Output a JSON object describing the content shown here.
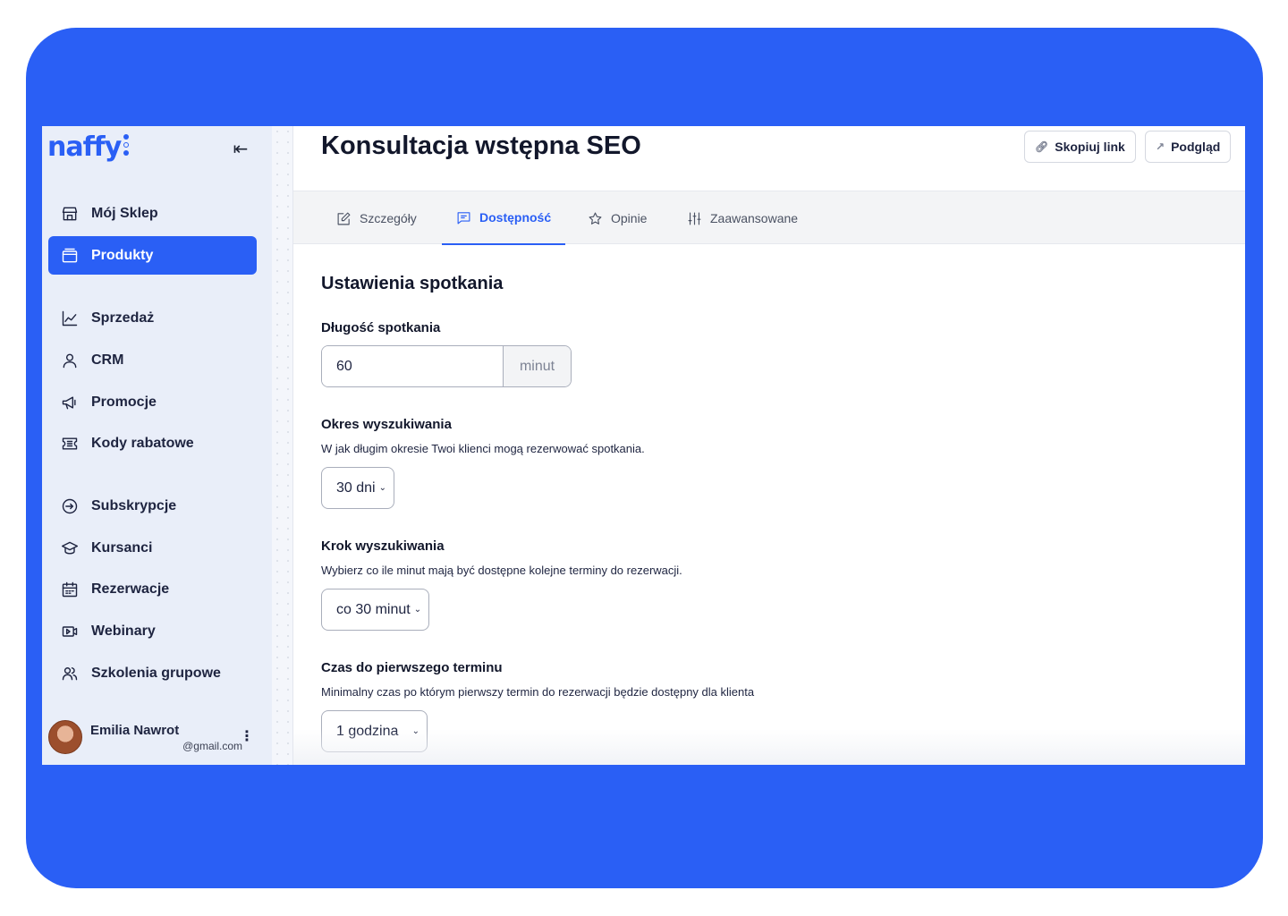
{
  "sidebar": {
    "logo": "naffy",
    "items": [
      {
        "label": "Mój Sklep",
        "icon": "store-icon"
      },
      {
        "label": "Produkty",
        "icon": "folder-icon",
        "active": true
      },
      {
        "label": "Sprzedaż",
        "icon": "chart-line-icon"
      },
      {
        "label": "CRM",
        "icon": "user-icon"
      },
      {
        "label": "Promocje",
        "icon": "megaphone-icon"
      },
      {
        "label": "Kody rabatowe",
        "icon": "ticket-icon"
      },
      {
        "label": "Subskrypcje",
        "icon": "subscription-icon"
      },
      {
        "label": "Kursanci",
        "icon": "graduation-cap-icon"
      },
      {
        "label": "Rezerwacje",
        "icon": "calendar-icon"
      },
      {
        "label": "Webinary",
        "icon": "video-icon"
      },
      {
        "label": "Szkolenia grupowe",
        "icon": "users-icon"
      }
    ],
    "user": {
      "name": "Emilia Nawrot",
      "email": "@gmail.com"
    }
  },
  "header": {
    "title": "Konsultacja wstępna SEO",
    "copy_link": "Skopiuj link",
    "preview": "Podgląd"
  },
  "tabs": [
    {
      "label": "Szczegóły",
      "icon": "edit-icon"
    },
    {
      "label": "Dostępność",
      "icon": "message-icon",
      "active": true
    },
    {
      "label": "Opinie",
      "icon": "star-icon"
    },
    {
      "label": "Zaawansowane",
      "icon": "sliders-icon"
    }
  ],
  "form": {
    "section_title": "Ustawienia spotkania",
    "duration": {
      "label": "Długość spotkania",
      "value": "60",
      "suffix": "minut"
    },
    "period": {
      "label": "Okres wyszukiwania",
      "description": "W jak długim okresie Twoi klienci mogą rezerwować spotkania.",
      "value": "30 dni"
    },
    "step": {
      "label": "Krok wyszukiwania",
      "description": "Wybierz co ile minut mają być dostępne kolejne terminy do rezerwacji.",
      "value": "co 30 minut"
    },
    "lead_time": {
      "label": "Czas do pierwszego terminu",
      "description": "Minimalny czas po którym pierwszy termin do rezerwacji będzie dostępny dla klienta",
      "value": "1 godzina"
    }
  },
  "colors": {
    "brand": "#2a5ff5",
    "sidebar_bg": "#e9eef9"
  }
}
